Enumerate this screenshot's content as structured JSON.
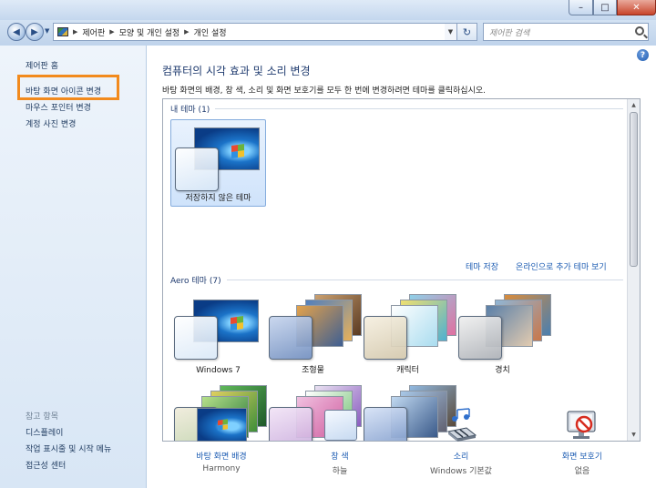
{
  "titlebar": {
    "min": "–",
    "max": "□",
    "close": "✕"
  },
  "nav": {
    "back": "◀",
    "forward": "▶",
    "dropdown": "▼",
    "separator": "▶",
    "breadcrumb": [
      "제어판",
      "모양 및 개인 설정",
      "개인 설정"
    ],
    "refresh": "↻",
    "search_placeholder": "제어판 검색"
  },
  "sidebar": {
    "home": "제어판 홈",
    "items": [
      "바탕 화면 아이콘 변경",
      "마우스 포인터 변경",
      "계정 사진 변경"
    ],
    "see_also_title": "참고 항목",
    "see_also": [
      "디스플레이",
      "작업 표시줄 및 시작 메뉴",
      "접근성 센터"
    ]
  },
  "main": {
    "help": "?",
    "heading": "컴퓨터의 시각 효과 및 소리 변경",
    "subtext": "바탕 화면의 배경, 창 색, 소리 및 화면 보호기를 모두 한 번에 변경하려면 테마를 클릭하십시오.",
    "my_themes_title": "내 테마 (1)",
    "my_themes": [
      {
        "label": "저장하지 않은 테마"
      }
    ],
    "save_theme": "테마 저장",
    "get_more_online": "온라인으로 추가 테마 보기",
    "aero_title": "Aero 테마 (7)",
    "aero_themes": [
      {
        "label": "Windows 7"
      },
      {
        "label": "조형물"
      },
      {
        "label": "캐릭터"
      },
      {
        "label": "경치"
      }
    ]
  },
  "bottom": {
    "background": {
      "title": "바탕 화면 배경",
      "value": "Harmony"
    },
    "color": {
      "title": "창 색",
      "value": "하늘"
    },
    "sounds": {
      "title": "소리",
      "value": "Windows 기본값"
    },
    "screensaver": {
      "title": "화면 보호기",
      "value": "없음"
    }
  },
  "colors": {
    "highlight": "#f28a1d",
    "link": "#1b5bb2",
    "heading": "#1e3a6e",
    "close": "#c8452b"
  }
}
